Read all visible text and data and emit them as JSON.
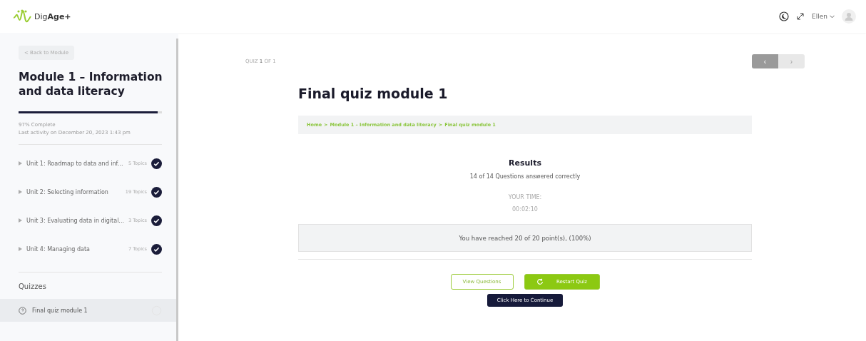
{
  "header": {
    "logo": {
      "plain": "Dig",
      "bold": "Age+"
    },
    "user": {
      "name": "Ellen"
    }
  },
  "sidebar": {
    "back_button": "< Back to Module",
    "title": "Module 1 – Information and data literacy",
    "progress": {
      "level": 0.97,
      "label": "97% Complete"
    },
    "last_activity": "Last activity on December 20, 2023 1:43 pm",
    "units": [
      {
        "title": "Unit 1: Roadmap to data and inf...",
        "topics": "5 Topics",
        "completed": true
      },
      {
        "title": "Unit 2: Selecting information",
        "topics": "19 Topics",
        "completed": true
      },
      {
        "title": "Unit 3: Evaluating data in digital...",
        "topics": "3 Topics",
        "completed": true
      },
      {
        "title": "Unit 4: Managing data",
        "topics": "7 Topics",
        "completed": true
      }
    ],
    "quizzes_heading": "Quizzes",
    "quizzes": [
      {
        "title": "Final quiz module 1",
        "selected": true,
        "completed": false
      }
    ]
  },
  "main": {
    "counter": "QUIZ **1** OF 1",
    "nav": [
      {
        "label": "‹",
        "disabled": false
      },
      {
        "label": "›",
        "disabled": true
      }
    ],
    "title": "Final quiz module 1",
    "breadcrumb_separator": ">",
    "breadcrumbs": [
      "Home",
      "Module 1 – Information and data literacy",
      "Final quiz module 1"
    ],
    "results": {
      "heading": "Results",
      "summary": "14 of 14 Questions answered correctly",
      "time_label": "YOUR TIME:",
      "time": "00:02:10",
      "points": "You have reached 20 of 20 point(s), (100%)"
    },
    "buttons": [
      {
        "label": "View Questions",
        "kind": "outline"
      },
      {
        "label": "Restart Quiz",
        "kind": "restart"
      }
    ],
    "continue": "Click Here to Continue"
  }
}
